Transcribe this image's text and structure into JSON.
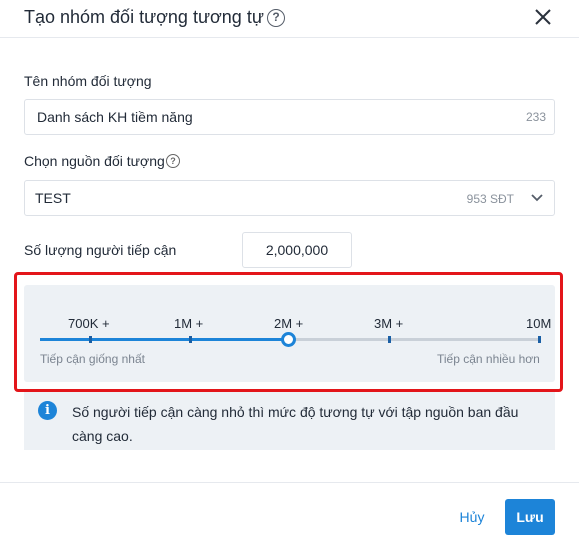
{
  "dialog": {
    "title": "Tạo nhóm đối tượng tương tự",
    "title_help_icon": "question-circle-icon",
    "close_icon": "close-icon"
  },
  "group_name": {
    "label": "Tên nhóm đối tượng",
    "value": "Danh sách KH tiềm năng",
    "char_count": "233"
  },
  "source": {
    "label": "Chọn nguồn đối tượng",
    "help_icon": "question-circle-icon",
    "selected": "TEST",
    "meta": "953 SĐT",
    "chevron_icon": "chevron-down-icon"
  },
  "reach": {
    "label": "Số lượng người tiếp cận",
    "value": "2,000,000"
  },
  "slider": {
    "ticks": [
      "700K +",
      "1M +",
      "2M +",
      "3M +",
      "10M"
    ],
    "selected_index": 2,
    "hint_left": "Tiếp cận giống nhất",
    "hint_right": "Tiếp cận nhiều hơn",
    "accent_color": "#1d84d8"
  },
  "info": {
    "icon": "info-icon",
    "text": "Số người tiếp cận càng nhỏ thì mức độ tương tự với tập nguồn ban đầu càng cao."
  },
  "footer": {
    "cancel_label": "Hủy",
    "save_label": "Lưu"
  }
}
